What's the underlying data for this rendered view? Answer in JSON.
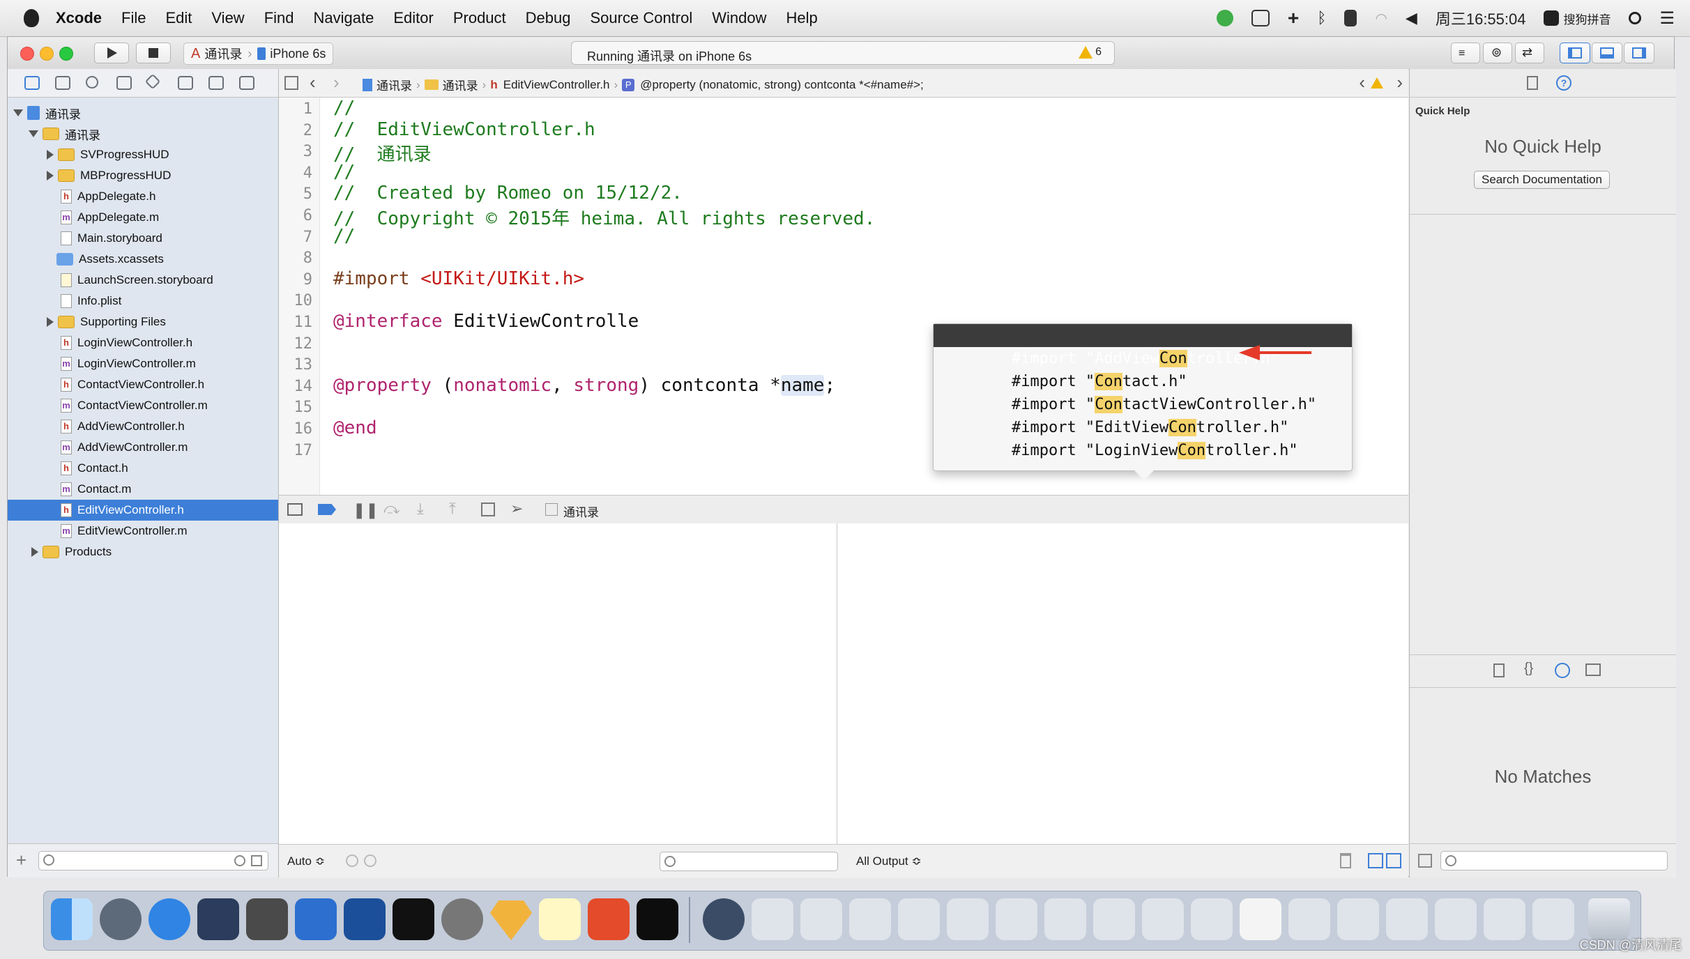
{
  "menubar": {
    "app": "Xcode",
    "items": [
      "File",
      "Edit",
      "View",
      "Find",
      "Navigate",
      "Editor",
      "Product",
      "Debug",
      "Source Control",
      "Window",
      "Help"
    ],
    "clock": "周三16:55:04",
    "input_method": "搜狗拼音"
  },
  "toolbar": {
    "scheme_target": "通讯录",
    "scheme_device": "iPhone 6s",
    "activity_text": "Running 通讯录 on iPhone 6s",
    "warning_count": "6"
  },
  "navigator": {
    "items": [
      {
        "label": "通讯录",
        "kind": "project",
        "indent": 0,
        "disclosure": "open"
      },
      {
        "label": "通讯录",
        "kind": "folder",
        "indent": 1,
        "disclosure": "open"
      },
      {
        "label": "SVProgressHUD",
        "kind": "folder",
        "indent": 2,
        "disclosure": "closed"
      },
      {
        "label": "MBProgressHUD",
        "kind": "folder",
        "indent": 2,
        "disclosure": "closed"
      },
      {
        "label": "AppDelegate.h",
        "kind": "h",
        "indent": 2
      },
      {
        "label": "AppDelegate.m",
        "kind": "m",
        "indent": 2
      },
      {
        "label": "Main.storyboard",
        "kind": "plain",
        "indent": 2
      },
      {
        "label": "Assets.xcassets",
        "kind": "assets",
        "indent": 2
      },
      {
        "label": "LaunchScreen.storyboard",
        "kind": "plain",
        "indent": 2
      },
      {
        "label": "Info.plist",
        "kind": "plain",
        "indent": 2
      },
      {
        "label": "Supporting Files",
        "kind": "folder",
        "indent": 2,
        "disclosure": "closed"
      },
      {
        "label": "LoginViewController.h",
        "kind": "h",
        "indent": 2
      },
      {
        "label": "LoginViewController.m",
        "kind": "m",
        "indent": 2
      },
      {
        "label": "ContactViewController.h",
        "kind": "h",
        "indent": 2
      },
      {
        "label": "ContactViewController.m",
        "kind": "m",
        "indent": 2
      },
      {
        "label": "AddViewController.h",
        "kind": "h",
        "indent": 2
      },
      {
        "label": "AddViewController.m",
        "kind": "m",
        "indent": 2
      },
      {
        "label": "Contact.h",
        "kind": "h",
        "indent": 2
      },
      {
        "label": "Contact.m",
        "kind": "m",
        "indent": 2
      },
      {
        "label": "EditViewController.h",
        "kind": "h",
        "indent": 2,
        "selected": true
      },
      {
        "label": "EditViewController.m",
        "kind": "m",
        "indent": 2
      },
      {
        "label": "Products",
        "kind": "folder",
        "indent": 1,
        "disclosure": "closed"
      }
    ]
  },
  "jumpbar": {
    "crumbs": [
      "通讯录",
      "通讯录",
      "EditViewController.h",
      "@property (nonatomic, strong) contconta *<#name#>;"
    ]
  },
  "editor": {
    "line_numbers": [
      "1",
      "2",
      "3",
      "4",
      "5",
      "6",
      "7",
      "8",
      "9",
      "10",
      "11",
      "12",
      "13",
      "14",
      "15",
      "16",
      "17"
    ],
    "lines": [
      "//",
      "//  EditViewController.h",
      "//  通讯录",
      "//",
      "//  Created by Romeo on 15/12/2.",
      "//  Copyright © 2015年 heima. All rights reserved.",
      "//",
      "",
      "#import <UIKit/UIKit.h>",
      "",
      "@interface EditViewControlle",
      "",
      "",
      "@property (nonatomic, strong) contconta *name;",
      "",
      "@end",
      ""
    ],
    "line9": {
      "kw": "#import",
      "str": "<UIKit/UIKit.h>"
    },
    "line11": {
      "kw": "@interface",
      "rest": "EditViewControlle"
    },
    "line14": {
      "kw": "@property",
      "open": "(",
      "a1": "nonatomic",
      "comma": ",",
      "a2": "strong",
      "close": ")",
      "type": "contconta",
      "star": "*",
      "placeholder": "name",
      "semi": ";"
    },
    "line16": {
      "kw": "@end"
    }
  },
  "completion": {
    "items": [
      {
        "pre": "#import \"AddView",
        "match": "Con",
        "post": "troller.h\"",
        "selected": true
      },
      {
        "pre": "#import \"",
        "match": "Con",
        "post": "tact.h\""
      },
      {
        "pre": "#import \"",
        "match": "Con",
        "post": "tactViewController.h\""
      },
      {
        "pre": "#import \"EditView",
        "match": "Con",
        "post": "troller.h\""
      },
      {
        "pre": "#import \"LoginView",
        "match": "Con",
        "post": "troller.h\""
      }
    ]
  },
  "debug": {
    "target_label": "通讯录",
    "auto_label": "Auto ≎",
    "output_label": "All Output ≎"
  },
  "inspector": {
    "title": "Quick Help",
    "no_help": "No Quick Help",
    "search_doc": "Search Documentation",
    "no_matches": "No Matches"
  },
  "watermark": "CSDN @清风清尾",
  "colors": {
    "selection": "#3d7fd8",
    "arrow": "#e53a2a",
    "completion_sel": "#3b3b3b"
  }
}
